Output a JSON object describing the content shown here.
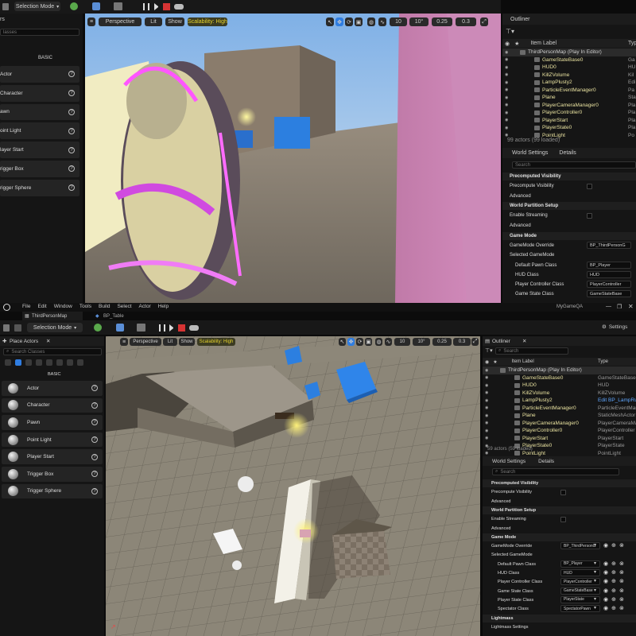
{
  "top": {
    "toolbar": {
      "mode": "Selection Mode"
    },
    "viewport": {
      "perspective": "Perspective",
      "lit": "Lit",
      "show": "Show",
      "scalability": "Scalability: High",
      "grid_snap": "10",
      "rot_snap": "10°",
      "scale_snap": "0.25",
      "cam_speed": "0.3"
    },
    "place_actors": {
      "search_placeholder": "lasses",
      "basic": "BASIC",
      "items": [
        "Actor",
        "Character",
        "awn",
        "oint Light",
        "layer Start",
        "rigger Box",
        "rigger Sphere"
      ]
    },
    "outliner": {
      "title": "Outliner",
      "col_label": "Item Label",
      "col_type": "Type",
      "items": [
        {
          "name": "ThirdPersonMap (Play In Editor)",
          "type": ""
        },
        {
          "name": "GameStateBase0",
          "type": "Ga"
        },
        {
          "name": "HUD0",
          "type": "HU"
        },
        {
          "name": "KillZVolume",
          "type": "Kil"
        },
        {
          "name": "LampPlusty2",
          "type": "Edi"
        },
        {
          "name": "ParticleEventManager0",
          "type": "Pa"
        },
        {
          "name": "Plane",
          "type": "Sta"
        },
        {
          "name": "PlayerCameraManager0",
          "type": "Pla"
        },
        {
          "name": "PlayerController0",
          "type": "Pla"
        },
        {
          "name": "PlayerStart",
          "type": "Pla"
        },
        {
          "name": "PlayerState0",
          "type": "Pla"
        },
        {
          "name": "PointLight",
          "type": "Po"
        }
      ],
      "count": "99 actors (99 loaded)"
    },
    "details": {
      "tab_world": "World Settings",
      "tab_details": "Details",
      "search": "Search",
      "precomputed": "Precomputed Visibility",
      "precompute": "Precompute Visibility",
      "advanced": "Advanced",
      "world_partition": "World Partition Setup",
      "enable_streaming": "Enable Streaming",
      "advanced2": "Advanced",
      "game_mode": "Game Mode",
      "gm_override_label": "GameMode Override",
      "gm_override_value": "BP_ThirdPersonG",
      "selected_gm": "Selected GameMode",
      "pawn_label": "Default Pawn Class",
      "pawn_value": "BP_Player",
      "hud_label": "HUD Class",
      "hud_value": "HUD",
      "pc_label": "Player Controller Class",
      "pc_value": "PlayerController",
      "gs_label": "Game State Class",
      "gs_value": "GameStateBase"
    }
  },
  "bottom": {
    "menu": [
      "File",
      "Edit",
      "Window",
      "Tools",
      "Build",
      "Select",
      "Actor",
      "Help"
    ],
    "project": "MyGameQA",
    "tabs": [
      "ThirdPersonMap",
      "BP_Table"
    ],
    "toolbar": {
      "mode": "Selection Mode",
      "settings": "Settings"
    },
    "viewport": {
      "perspective": "Perspective",
      "lit": "Lit",
      "show": "Show",
      "scalability": "Scalability: High",
      "grid_snap": "10",
      "rot_snap": "10°",
      "scale_snap": "0.25",
      "cam_speed": "0.3"
    },
    "place_actors": {
      "title": "Place Actors",
      "search_placeholder": "Search Classes",
      "basic": "BASIC",
      "items": [
        "Actor",
        "Character",
        "Pawn",
        "Point Light",
        "Player Start",
        "Trigger Box",
        "Trigger Sphere"
      ]
    },
    "outliner": {
      "title": "Outliner",
      "search": "Search",
      "col_label": "Item Label",
      "col_type": "Type",
      "items": [
        {
          "name": "ThirdPersonMap (Play In Editor)",
          "type": ""
        },
        {
          "name": "GameStateBase0",
          "type": "GameStateBase"
        },
        {
          "name": "HUD0",
          "type": "HUD"
        },
        {
          "name": "KillZVolume",
          "type": "KillZVolume"
        },
        {
          "name": "LampPlusty2",
          "type": "Edit BP_LampRu"
        },
        {
          "name": "ParticleEventManager0",
          "type": "ParticleEventMar"
        },
        {
          "name": "Plane",
          "type": "StaticMeshActor"
        },
        {
          "name": "PlayerCameraManager0",
          "type": "PlayerCameraMa"
        },
        {
          "name": "PlayerController0",
          "type": "PlayerController"
        },
        {
          "name": "PlayerStart",
          "type": "PlayerStart"
        },
        {
          "name": "PlayerState0",
          "type": "PlayerState"
        },
        {
          "name": "PointLight",
          "type": "PointLight"
        }
      ],
      "count": "59 actors (59 loaded)"
    },
    "details": {
      "tab_world": "World Settings",
      "tab_details": "Details",
      "search": "Search",
      "precomputed": "Precomputed Visibility",
      "precompute": "Precompute Visibility",
      "advanced": "Advanced",
      "world_partition": "World Partition Setup",
      "enable_streaming": "Enable Streaming",
      "advanced2": "Advanced",
      "game_mode": "Game Mode",
      "gm_override_label": "GameMode Override",
      "gm_override_value": "BP_ThirdPersonG",
      "selected_gm": "Selected GameMode",
      "pawn_label": "Default Pawn Class",
      "pawn_value": "BP_Player",
      "hud_label": "HUD Class",
      "hud_value": "HUD",
      "pc_label": "Player Controller Class",
      "pc_value": "PlayerController",
      "gs_label": "Game State Class",
      "gs_value": "GameStateBase",
      "ps_label": "Player State Class",
      "ps_value": "PlayerState",
      "sp_label": "Spectator Class",
      "sp_value": "SpectatorPawn",
      "lightmass": "Lightmass",
      "lightmass_settings": "Lightmass Settings"
    }
  },
  "colors": {
    "accent": "#2f7de1",
    "scalability": "#e6d42c",
    "play": "#e0e0e0",
    "stop": "#d63333"
  }
}
